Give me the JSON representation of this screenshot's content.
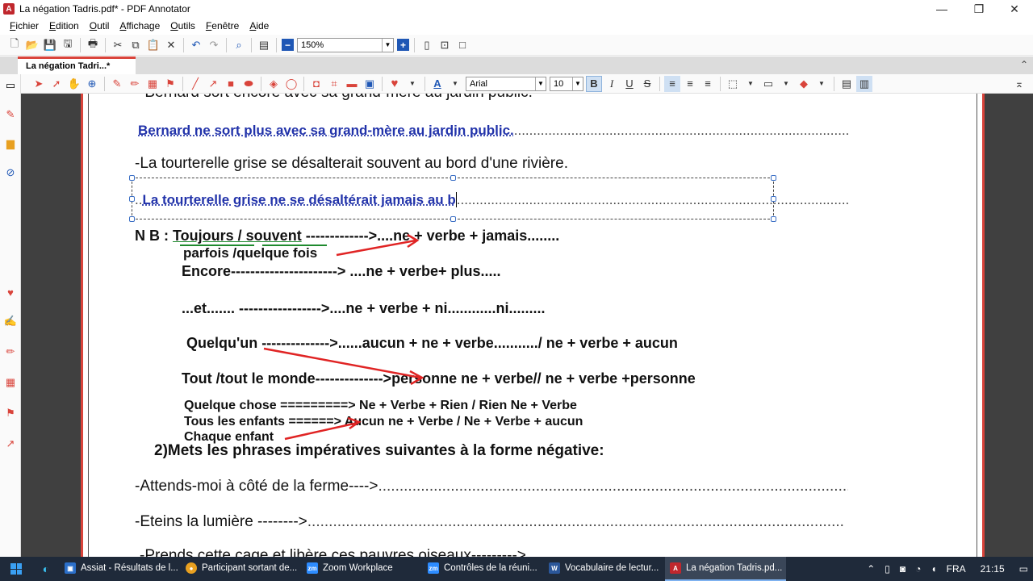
{
  "window": {
    "title": "La négation Tadris.pdf* - PDF Annotator",
    "controls": {
      "minimize": "—",
      "restore": "❐",
      "close": "✕"
    }
  },
  "menu": [
    "Fichier",
    "Edition",
    "Outil",
    "Affichage",
    "Outils",
    "Fenêtre",
    "Aide"
  ],
  "toolbar": {
    "zoom_value": "150%"
  },
  "tab": {
    "label": "La négation Tadri...*"
  },
  "format_bar": {
    "font": "Arial",
    "size": "10"
  },
  "document": {
    "l1": "-Bernard sort encore avec sa grand-mère au jardin public.",
    "l2_answer": "Bernard ne sort plus avec sa grand-mère au jardin public.",
    "l3": "-La tourterelle grise se désalterait souvent au bord d'une rivière.",
    "l4_answer": "La tourterelle grise ne se désaltérait jamais au b",
    "nb_label": "N B :",
    "nb_toujours": "Toujours / souvent",
    "nb_toujours_rule": "------------->....ne + verbe + jamais........",
    "nb_parfois": "parfois /quelque fois",
    "nb_encore": "Encore----------------------> ....ne + verbe+ plus.....",
    "nb_et": "...et....... ----------------->....ne + verbe + ni............ni.........",
    "nb_quelquun": "Quelqu'un -------------->......aucun + ne + verbe.........../ ne + verbe + aucun",
    "nb_tout": "Tout /tout le monde-------------->personne ne + verbe// ne + verbe +personne",
    "nb_chose": "Quelque chose =========> Ne + Verbe + Rien / Rien Ne + Verbe",
    "nb_enfants": "Tous les enfants ======> Aucun ne + Verbe / Ne + Verbe + aucun",
    "nb_chaque": "Chaque enfant",
    "section2": "2)Mets les phrases impératives suivantes à la forme négative:",
    "ex1": "-Attends-moi à côté de la ferme---->",
    "ex2": "-Eteins la lumière -------->",
    "ex3": "-Prends cette cage et libère ces pauvres oiseaux--------->"
  },
  "taskbar": {
    "apps": [
      {
        "label": "Assiat - Résultats de l...",
        "icon_color": "#2b6fc9"
      },
      {
        "label": "Participant sortant de...",
        "icon_color": "#e8a020"
      },
      {
        "label": "Zoom Workplace",
        "icon_color": "#2d8cff"
      },
      {
        "label": "Contrôles de la réuni...",
        "icon_color": "#2d8cff"
      },
      {
        "label": "Vocabulaire de lectur...",
        "icon_color": "#2b579a"
      },
      {
        "label": "La négation Tadris.pd...",
        "icon_color": "#c0272d"
      }
    ],
    "tray": {
      "lang": "FRA",
      "time": "21:15"
    }
  }
}
